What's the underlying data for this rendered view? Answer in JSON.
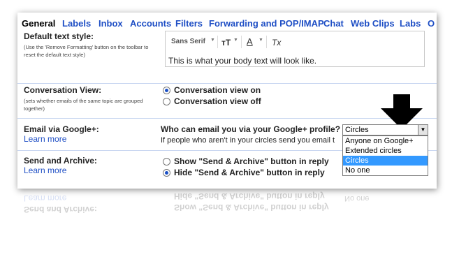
{
  "tabs": [
    {
      "label": "General",
      "active": true
    },
    {
      "label": "Labels"
    },
    {
      "label": "Inbox"
    },
    {
      "label": "Accounts"
    },
    {
      "label": "Filters"
    },
    {
      "label": "Forwarding and POP/IMAP"
    },
    {
      "label": "Chat"
    },
    {
      "label": "Web Clips"
    },
    {
      "label": "Labs"
    },
    {
      "label": "O"
    }
  ],
  "default_text_style": {
    "label": "Default text style:",
    "hint": "(Use the 'Remove Formatting' button on the toolbar to reset the default text style)",
    "font_name": "Sans Serif",
    "size_icon": "text-size-icon",
    "color_icon": "text-color-icon",
    "clear_icon": "remove-formatting-icon",
    "size_glyph": "тT",
    "color_glyph": "A",
    "clear_glyph": "Tx",
    "preview": "This is what your body text will look like."
  },
  "conversation_view": {
    "label": "Conversation View:",
    "hint": "(sets whether emails of the same topic are grouped together)",
    "options": [
      "Conversation view on",
      "Conversation view off"
    ],
    "selected": 0
  },
  "email_via_gplus": {
    "label": "Email via Google+:",
    "learn_more": "Learn more",
    "question": "Who can email you via your Google+ profile?",
    "description": "If people who aren't in your circles send you email t",
    "select_value": "Circles",
    "dropdown_options": [
      "Anyone on Google+",
      "Extended circles",
      "Circles",
      "No one"
    ],
    "highlighted": 2
  },
  "send_and_archive": {
    "label": "Send and Archive:",
    "learn_more": "Learn more",
    "options": [
      "Show \"Send & Archive\" button in reply",
      "Hide \"Send & Archive\" button in reply"
    ],
    "selected": 1
  },
  "colors": {
    "link": "#1f4fc5",
    "section_border": "#c9d7f1",
    "highlight": "#3399ff"
  }
}
